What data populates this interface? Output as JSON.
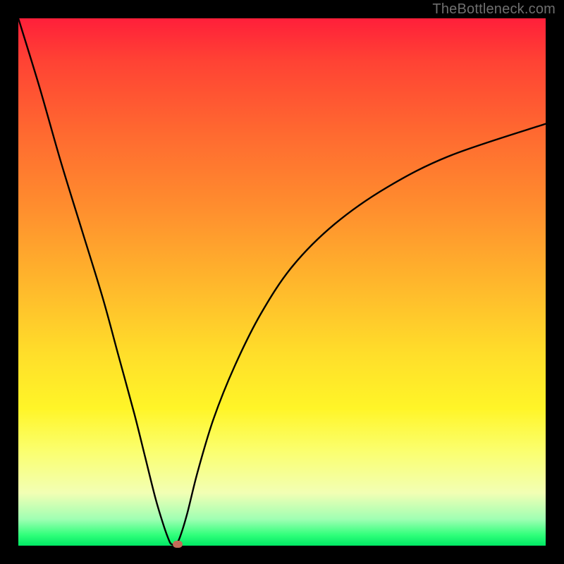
{
  "watermark": "TheBottleneck.com",
  "colors": {
    "frame": "#000000",
    "curve": "#000000",
    "marker": "#c46a58",
    "gradient_top": "#ff1f3a",
    "gradient_bottom": "#00e864"
  },
  "chart_data": {
    "type": "line",
    "title": "",
    "xlabel": "",
    "ylabel": "",
    "xlim": [
      0,
      100
    ],
    "ylim": [
      0,
      100
    ],
    "annotations": [],
    "series": [
      {
        "name": "bottleneck-curve",
        "x": [
          0,
          4,
          8,
          12,
          16,
          19,
          22,
          24,
          26,
          27.5,
          28.5,
          29,
          29.8,
          30.6,
          32,
          34,
          37,
          41,
          46,
          52,
          60,
          70,
          82,
          100
        ],
        "y": [
          100,
          87,
          73,
          60,
          47,
          36,
          25,
          17,
          9,
          4,
          1.2,
          0.3,
          0.3,
          1.5,
          6,
          14,
          24,
          34,
          44,
          53,
          61,
          68,
          74,
          80
        ]
      }
    ],
    "marker": {
      "x": 30.2,
      "y": 0.3
    }
  }
}
